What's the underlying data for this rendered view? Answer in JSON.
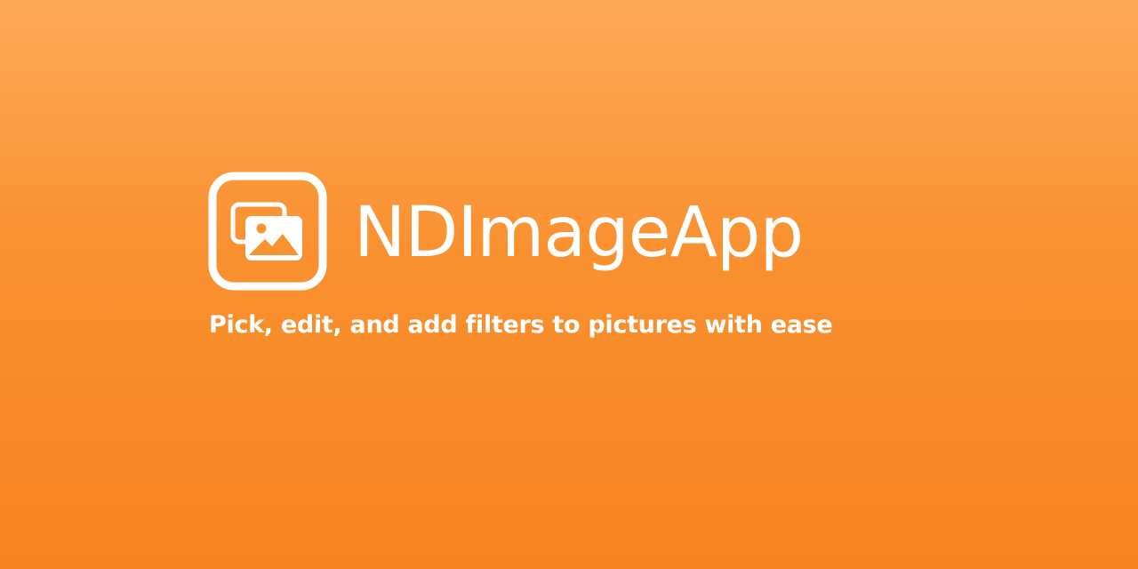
{
  "brand": {
    "title": "NDImageApp",
    "tagline": "Pick, edit, and add filters to pictures with ease",
    "icon": "stacked-images-icon"
  },
  "colors": {
    "background_top": "#fcaa58",
    "background_bottom": "#f78420",
    "foreground": "#ffffff"
  }
}
